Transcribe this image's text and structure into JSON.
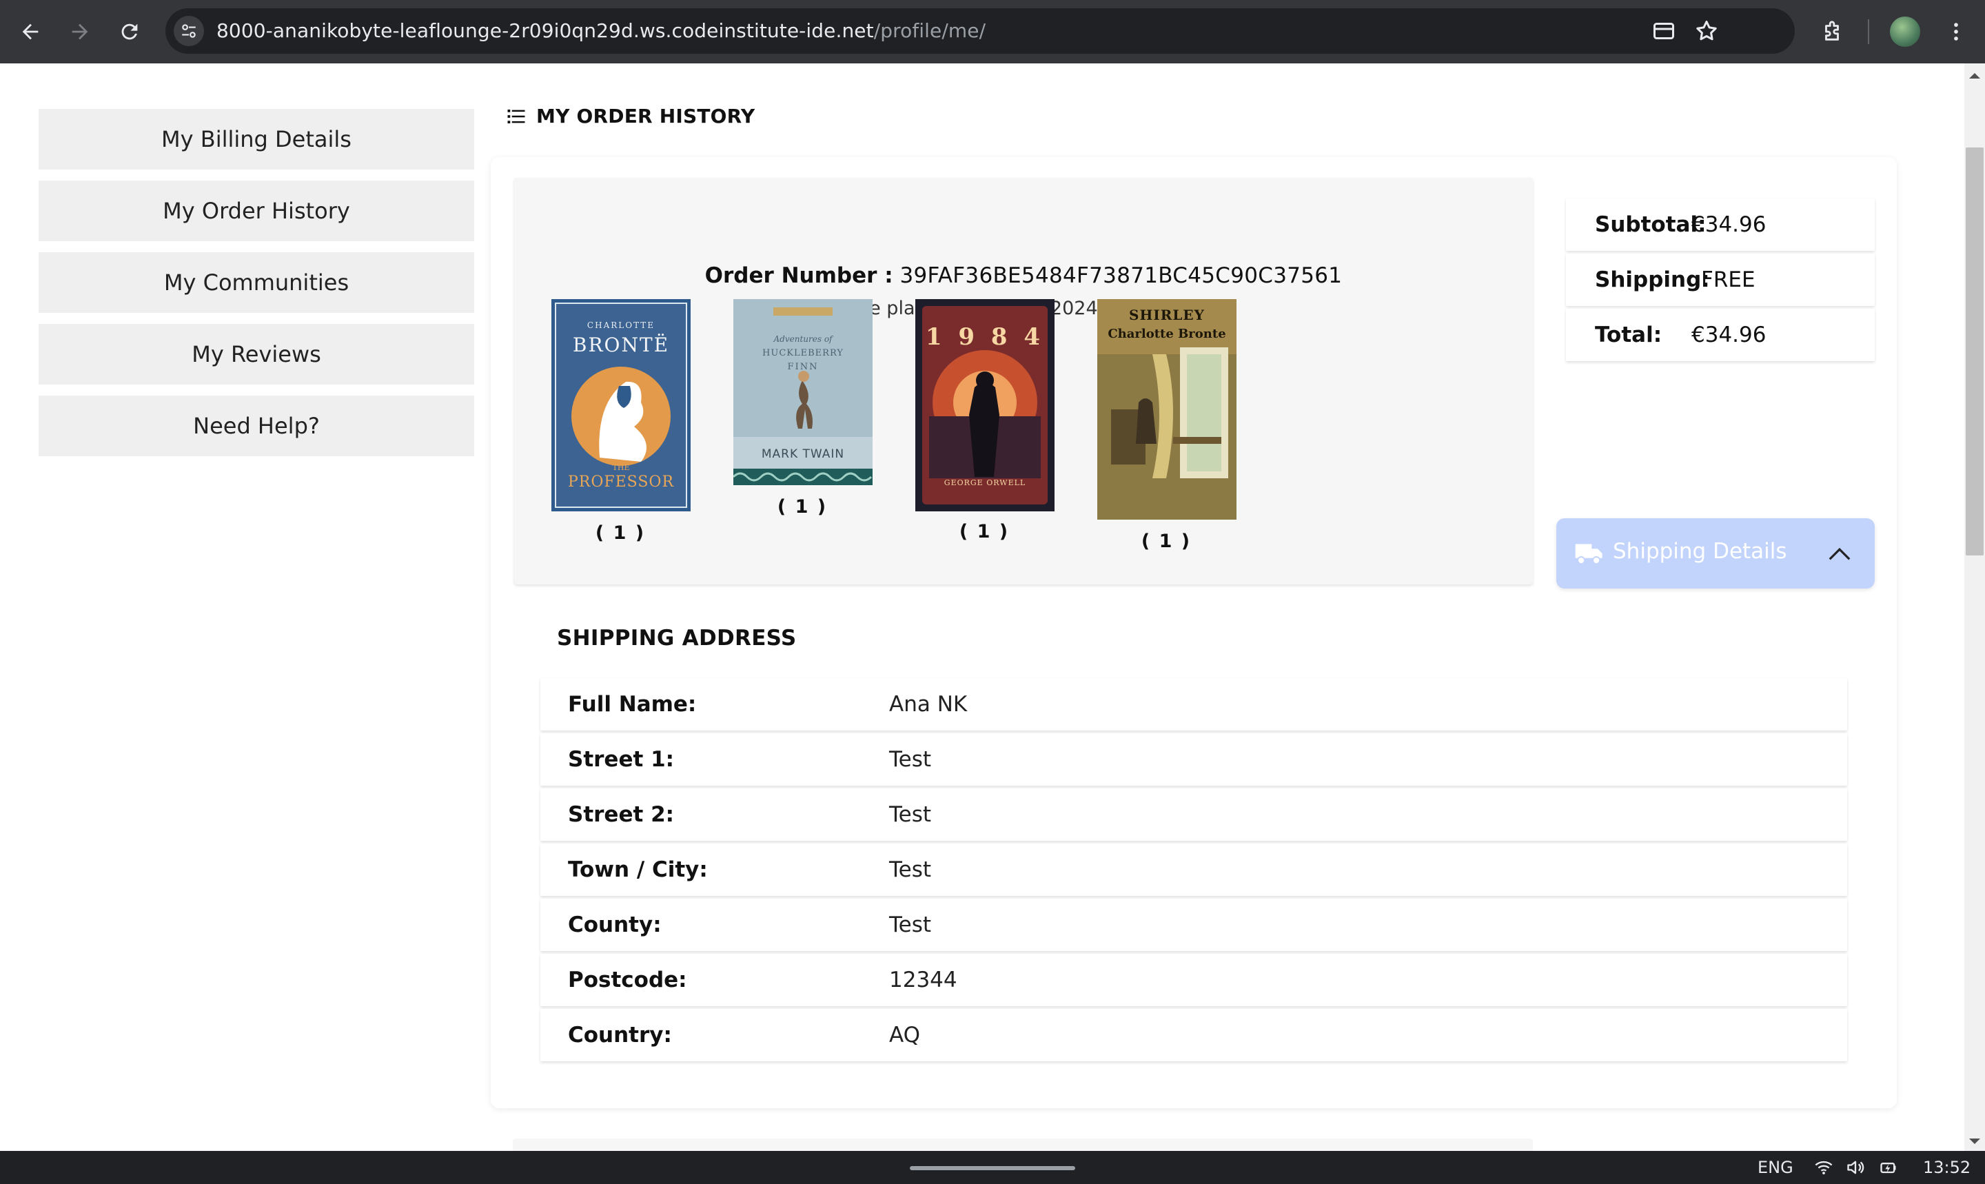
{
  "browser": {
    "url_host": "8000-ananikobyte-leaflounge-2r09i0qn29d.ws.codeinstitute-ide.net",
    "url_path": "/profile/me/"
  },
  "sidebar": {
    "items": [
      {
        "label": "My Billing Details"
      },
      {
        "label": "My Order History"
      },
      {
        "label": "My Communities"
      },
      {
        "label": "My Reviews"
      },
      {
        "label": "Need Help?"
      }
    ]
  },
  "section": {
    "title": "MY ORDER HISTORY"
  },
  "order": {
    "number_label": "Order Number :",
    "number": "39FAF36BE5484F73871BC45C90C37561",
    "date": "Date placed: Sept. 20, 2024, 12:50 p.m.",
    "books": [
      {
        "cover_author": "CHARLOTTE",
        "cover_title": "BRONTË",
        "cover_subtitle": "THE",
        "cover_subtitle2": "PROFESSOR",
        "qty": "( 1 )"
      },
      {
        "cover_author": "MARK TWAIN",
        "cover_title": "Adventures of",
        "cover_subtitle": "HUCKLEBERRY",
        "cover_subtitle2": "FINN",
        "qty": "( 1 )"
      },
      {
        "cover_author": "GEORGE ORWELL",
        "cover_title": "1 9 8 4",
        "qty": "( 1 )"
      },
      {
        "cover_author": "Charlotte Bronte",
        "cover_title": "SHIRLEY",
        "qty": "( 1 )"
      }
    ],
    "summary": {
      "subtotal_label": "Subtotal:",
      "subtotal": "€34.96",
      "shipping_label": "Shipping:",
      "shipping": "FREE",
      "total_label": "Total:",
      "total": "€34.96"
    },
    "shipping_toggle": "Shipping Details"
  },
  "address": {
    "title": "SHIPPING ADDRESS",
    "rows": [
      {
        "k": "Full Name:",
        "v": "Ana NK"
      },
      {
        "k": "Street 1:",
        "v": "Test"
      },
      {
        "k": "Street 2:",
        "v": "Test"
      },
      {
        "k": "Town / City:",
        "v": "Test"
      },
      {
        "k": "County:",
        "v": "Test"
      },
      {
        "k": "Postcode:",
        "v": "12344"
      },
      {
        "k": "Country:",
        "v": "AQ"
      }
    ]
  },
  "taskbar": {
    "lang": "ENG",
    "time": "13:52"
  },
  "colors": {
    "toggle_bg": "#c3d4fc",
    "panel_bg": "#f6f6f7",
    "sidebar_btn": "#efefef"
  }
}
